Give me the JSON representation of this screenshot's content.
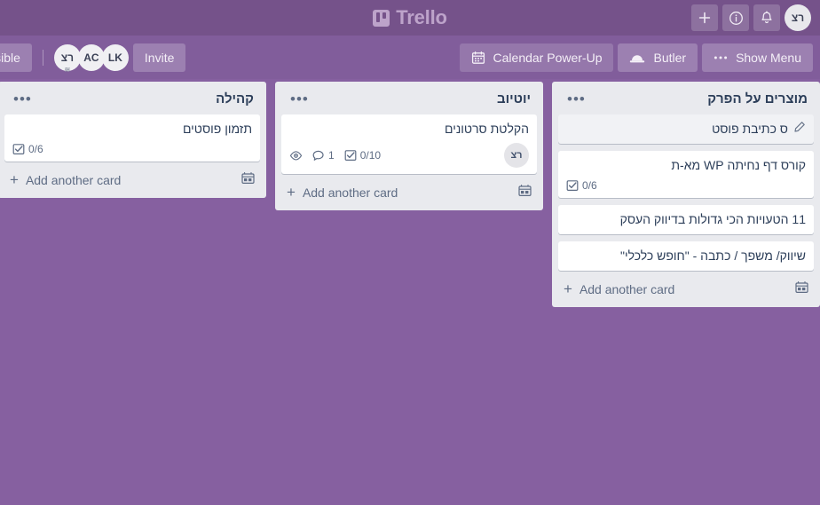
{
  "header": {
    "brand": "Trello",
    "brand_icon": "trello-board-icon",
    "actions": [
      {
        "name": "add-button",
        "icon": "plus-icon"
      },
      {
        "name": "info-button",
        "icon": "info-circle-icon"
      },
      {
        "name": "notifications-button",
        "icon": "bell-icon"
      }
    ],
    "avatar_initials": "רצ"
  },
  "board_bar": {
    "visibility_label": "isible",
    "members": [
      {
        "initials": "רצ",
        "rtl": true,
        "has_wave": true
      },
      {
        "initials": "AC",
        "rtl": false,
        "has_wave": false
      },
      {
        "initials": "LK",
        "rtl": false,
        "has_wave": false
      }
    ],
    "invite_label": "Invite",
    "calendar_powerup_label": "Calendar Power-Up",
    "calendar_icon": "calendar-icon",
    "butler_label": "Butler",
    "butler_icon": "butler-hat-icon",
    "show_menu_label": "Show Menu",
    "show_menu_icon": "ellipsis-icon"
  },
  "lists": [
    {
      "title": "קהילה",
      "menu_icon": "ellipsis-icon",
      "add_card_label": "Add another card",
      "template_icon": "card-template-icon",
      "cards": [
        {
          "title": "תזמון פוסטים",
          "hovered": false,
          "edit_icon": null,
          "badges": [
            {
              "type": "checklist",
              "icon": "checklist-icon",
              "text": "0/6"
            }
          ],
          "avatar": null
        }
      ]
    },
    {
      "title": "יוטיוב",
      "menu_icon": "ellipsis-icon",
      "add_card_label": "Add another card",
      "template_icon": "card-template-icon",
      "cards": [
        {
          "title": "הקלטת סרטונים",
          "hovered": false,
          "edit_icon": null,
          "badges": [
            {
              "type": "watching",
              "icon": "eye-icon",
              "text": ""
            },
            {
              "type": "comments",
              "icon": "comment-icon",
              "text": "1"
            },
            {
              "type": "checklist",
              "icon": "checklist-icon",
              "text": "0/10"
            }
          ],
          "avatar": "רצ"
        }
      ]
    },
    {
      "title": "מוצרים על הפרק",
      "menu_icon": "ellipsis-icon",
      "add_card_label": "Add another card",
      "template_icon": "card-template-icon",
      "cards": [
        {
          "title": "ס כתיבת פוסט",
          "hovered": true,
          "edit_icon": "pencil-icon",
          "badges": [],
          "avatar": null
        },
        {
          "title": "קורס דף נחיתה WP מא-ת",
          "hovered": false,
          "edit_icon": null,
          "badges": [
            {
              "type": "checklist",
              "icon": "checklist-icon",
              "text": "0/6"
            }
          ],
          "avatar": null
        },
        {
          "title": "11 הטעויות הכי גדולות בדיווק העסק",
          "hovered": false,
          "edit_icon": null,
          "badges": [],
          "avatar": null
        },
        {
          "title": "שיווק/ משפך / כתבה - \"חופש כלכלי\"",
          "hovered": false,
          "edit_icon": null,
          "badges": [],
          "avatar": null
        }
      ]
    }
  ],
  "colors": {
    "board_background": "#8660a0",
    "header_background": "#75528a",
    "list_background": "#e9eaee",
    "card_background": "#ffffff",
    "text_dark": "#2c3e59",
    "text_muted": "#5e6c84"
  }
}
